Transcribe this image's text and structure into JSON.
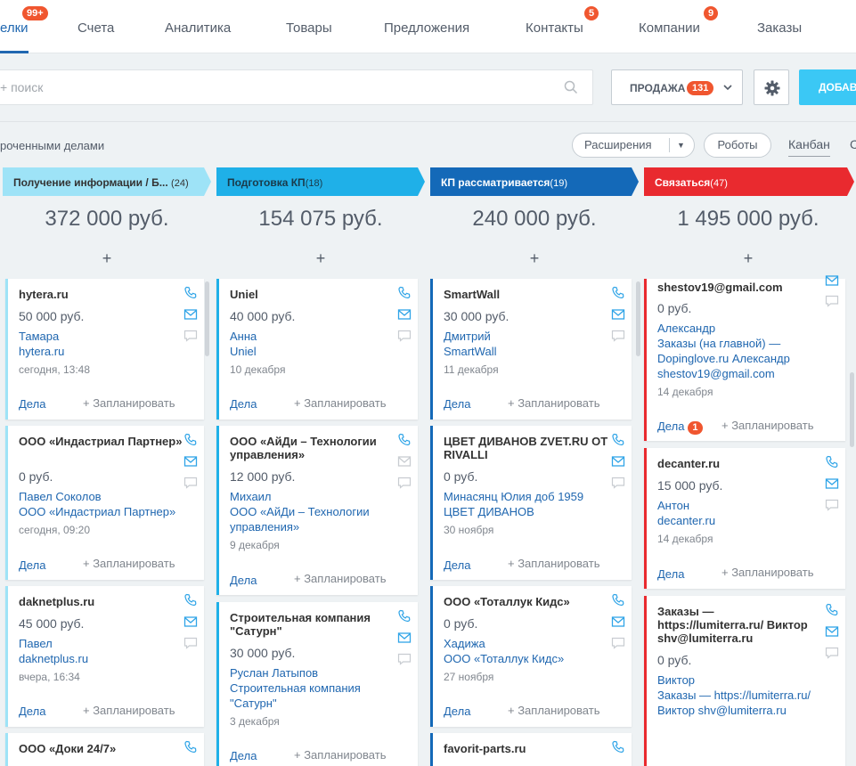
{
  "nav": {
    "tabs": [
      {
        "label": "елки",
        "badge": "99+"
      },
      {
        "label": "Счета"
      },
      {
        "label": "Аналитика"
      },
      {
        "label": "Товары"
      },
      {
        "label": "Предложения"
      },
      {
        "label": "Контакты",
        "badge": "5"
      },
      {
        "label": "Компании",
        "badge": "9"
      },
      {
        "label": "Заказы"
      }
    ]
  },
  "toolbar": {
    "search_placeholder": "+ поиск",
    "category_label": "ПРОДАЖА",
    "category_count": "131",
    "add_label": "ДОБАВ"
  },
  "filters": {
    "overdue_label": "роченными делами",
    "extensions_label": "Расширения",
    "robots_label": "Роботы",
    "view_kanban": "Канбан",
    "view_next": "С"
  },
  "columns": [
    {
      "title": "Получение информации / Б...",
      "count": "(24)",
      "sum": "372 000 руб.",
      "plus": "+",
      "color": "#9ee3f7",
      "text_color": "#333333",
      "cards": [
        {
          "title": "hytera.ru",
          "sum": "50 000 руб.",
          "links": [
            "Тамара",
            "hytera.ru"
          ],
          "date": "сегодня, 13:48",
          "deals": "Дела",
          "plan": "+ Запланировать"
        },
        {
          "title": "ООО «Индастриал Партнер»",
          "sum": "0 руб.",
          "links": [
            "Павел Соколов",
            "ООО «Индастриал Партнер»"
          ],
          "date": "сегодня, 09:20",
          "deals": "Дела",
          "plan": "+ Запланировать"
        },
        {
          "title": "daknetplus.ru",
          "sum": "45 000 руб.",
          "links": [
            "Павел",
            "daknetplus.ru"
          ],
          "date": "вчера, 16:34",
          "deals": "Дела",
          "plan": "+ Запланировать"
        },
        {
          "title": "ООО «Доки 24/7»"
        }
      ]
    },
    {
      "title": "Подготовка КП",
      "count": "(18)",
      "sum": "154 075 руб.",
      "plus": "+",
      "color": "#1fb0e8",
      "text_color": "#1a3a4a",
      "cards": [
        {
          "title": "Uniel",
          "sum": "40 000 руб.",
          "links": [
            "Анна",
            "Uniel"
          ],
          "date": "10 декабря",
          "deals": "Дела",
          "plan": "+ Запланировать"
        },
        {
          "title": "ООО «АйДи – Технологии управления»",
          "sum": "12 000 руб.",
          "links": [
            "Михаил",
            "ООО «АйДи – Технологии управления»"
          ],
          "date": "9 декабря",
          "deals": "Дела",
          "plan": "+ Запланировать"
        },
        {
          "title": "Строительная компания \"Сатурн\"",
          "sum": "30 000 руб.",
          "links": [
            "Руслан Латыпов",
            "Строительная компания \"Сатурн\""
          ],
          "date": "3 декабря",
          "deals": "Дела",
          "plan": "+ Запланировать"
        }
      ]
    },
    {
      "title": "КП рассматривается",
      "count": "(19)",
      "sum": "240 000 руб.",
      "plus": "+",
      "color": "#1469b8",
      "text_color": "#ffffff",
      "cards": [
        {
          "title": "SmartWall",
          "sum": "30 000 руб.",
          "links": [
            "Дмитрий",
            "SmartWall"
          ],
          "date": "11 декабря",
          "deals": "Дела",
          "plan": "+ Запланировать"
        },
        {
          "title": "ЦВЕТ ДИВАНОВ ZVET.RU ОТ RIVALLI",
          "sum": "0 руб.",
          "links": [
            "Минасянц Юлия доб 1959",
            "ЦВЕТ ДИВАНОВ"
          ],
          "date": "30 ноября",
          "deals": "Дела",
          "plan": "+ Запланировать"
        },
        {
          "title": "ООО «Тоталлук Кидс»",
          "sum": "0 руб.",
          "links": [
            "Хадижа",
            "ООО «Тоталлук Кидс»"
          ],
          "date": "27 ноября",
          "deals": "Дела",
          "plan": "+ Запланировать"
        },
        {
          "title": "favorit-parts.ru"
        }
      ]
    },
    {
      "title": "Связаться",
      "count": "(47)",
      "sum": "1 495 000 руб.",
      "plus": "+",
      "color": "#e92a2f",
      "text_color": "#ffffff",
      "cards": [
        {
          "title": "shestov19@gmail.com",
          "sum": "0 руб.",
          "links": [
            "Александр",
            "Заказы (на главной) — Dopinglove.ru Александр shestov19@gmail.com"
          ],
          "date": "14 декабря",
          "deals": "Дела",
          "deals_badge": "1",
          "plan": "+ Запланировать"
        },
        {
          "title": "decanter.ru",
          "sum": "15 000 руб.",
          "links": [
            "Антон",
            "decanter.ru"
          ],
          "date": "14 декабря",
          "deals": "Дела",
          "plan": "+ Запланировать"
        },
        {
          "title": "Заказы — https://lumiterra.ru/ Виктор shv@lumiterra.ru",
          "sum": "0 руб.",
          "links": [
            "Виктор",
            "Заказы — https://lumiterra.ru/ Виктор shv@lumiterra.ru"
          ]
        }
      ]
    }
  ],
  "colors": {
    "accent": "#2067b0",
    "badge": "#f0562f",
    "add_button": "#3bc8f5",
    "icon": "#2fa4e7"
  }
}
